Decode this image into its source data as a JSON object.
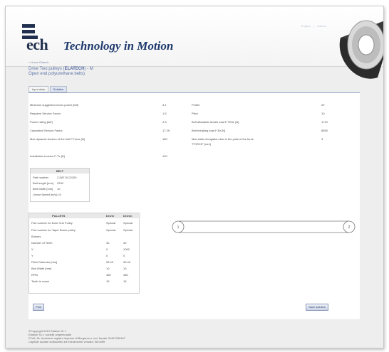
{
  "header": {
    "logo_word": "ech",
    "tagline": "Technology in Motion",
    "top_links": [
      "English",
      "Italiano"
    ]
  },
  "breadcrumb": "< Home Elatech",
  "title": {
    "line1_prefix": "Drive Two pulleys (",
    "line1_bold": "ELATECH",
    "line1_suffix": ") - M",
    "line2": "Open end polyurethane belts)"
  },
  "tabs": [
    {
      "label": "Input data",
      "active": false
    },
    {
      "label": "Solution",
      "active": true
    }
  ],
  "results_left": [
    {
      "label": "Minimum suggested motor power [kW]",
      "value": "3.1"
    },
    {
      "label": "Required Service Factor",
      "value": "1.5"
    },
    {
      "label": "Power rating [kW]",
      "value": "2.8"
    },
    {
      "label": "Calculated Service Factor",
      "value": "17.29"
    },
    {
      "label": "Max dynamic tension of the belt F.Tmax [N]",
      "value": "180"
    }
  ],
  "installation": {
    "label": "Installation tension F-Tv [N]",
    "value": "120"
  },
  "results_right": [
    {
      "label": "Profile",
      "value": "AT"
    },
    {
      "label": "Pitch",
      "value": "10"
    },
    {
      "label": "Belt allowable tensile load F.TZUL [N]",
      "value": "1710"
    },
    {
      "label": "Belt breaking load F-Br [N]",
      "value": "8550"
    },
    {
      "label": "Max static elongation due to the pulls of the force",
      "value": "3"
    }
  ],
  "elongation_unit": "\"FORCE\" [mm]",
  "belt": {
    "header": "BELT",
    "rows": [
      {
        "label": "Part number",
        "value": "2-5AT10-02200"
      },
      {
        "label": "Belt length [mm]",
        "value": "2200"
      },
      {
        "label": "Belt Width [mm]",
        "value": "10"
      },
      {
        "label": "Linear Speed [m/s]",
        "value": "1.8"
      }
    ]
  },
  "pulleys": {
    "header": "PULLEYS",
    "col_driver": "Driver",
    "col_driven": "Driven",
    "rows": [
      {
        "label": "Part number for Bore Hub Pulley",
        "a": "Special",
        "b": "Special"
      },
      {
        "label": "Part number for Taper Bores pulley",
        "a": "Special",
        "b": "Special"
      },
      {
        "label": "Bushes",
        "a": "",
        "b": ""
      },
      {
        "label": "Number of Teeth",
        "a": "30",
        "b": "30"
      },
      {
        "label": "X",
        "a": "0",
        "b": "1000"
      },
      {
        "label": "Y",
        "a": "0",
        "b": "0"
      },
      {
        "label": "Pitch Diameter [mm]",
        "a": "95.49",
        "b": "95.49"
      },
      {
        "label": "Belt Width [mm]",
        "a": "10",
        "b": "10"
      },
      {
        "label": "RPM",
        "a": "480",
        "b": "480"
      },
      {
        "label": "Teeth in mesh",
        "a": "15",
        "b": "15"
      }
    ]
  },
  "drive_diagram": {
    "pulley1": "1",
    "pulley2": "2"
  },
  "buttons": {
    "print": "Print",
    "save": "Save solution"
  },
  "footer": [
    "©Copyright 2012 Elatech S.r.l.",
    "Elatech S.r.l. società unipersonale",
    "P.IVA, Nr. iscrizione registro imprese di Bergamo e cod. fiscale 02497030167",
    "Capitale sociale sottoscritto ed interamente versato: 98.000€"
  ],
  "colors": {
    "brand_navy": "#1f2f4d",
    "link_blue": "#5b74a8",
    "panel_bg": "#ffffff",
    "frame_bg": "#eeeeee"
  }
}
